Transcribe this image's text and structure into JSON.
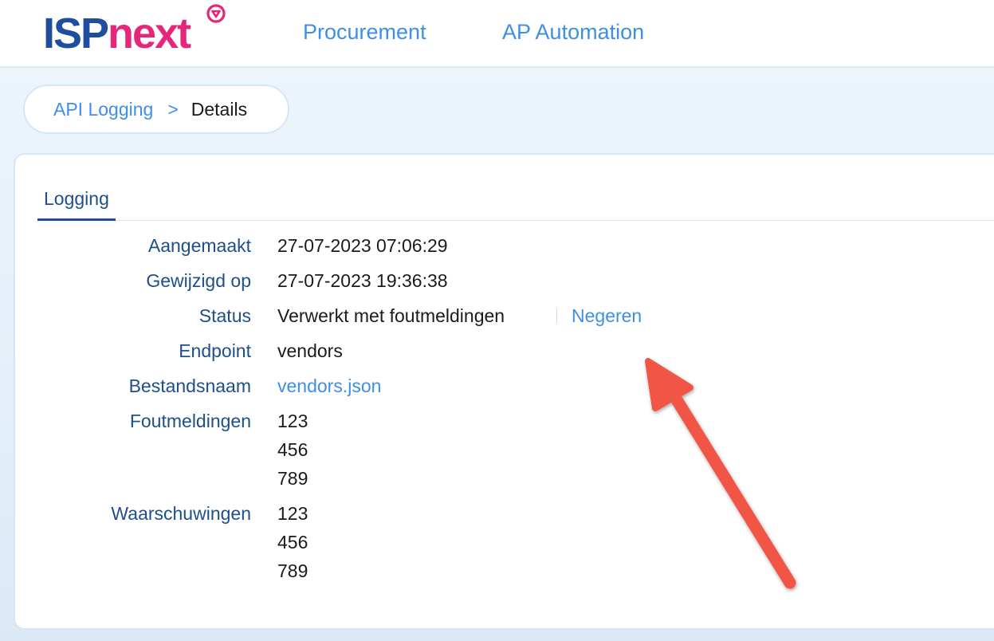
{
  "header": {
    "logo": {
      "part1": "ISP",
      "part2": "next"
    },
    "nav": [
      {
        "label": "Procurement"
      },
      {
        "label": "AP Automation"
      }
    ]
  },
  "breadcrumb": {
    "parent": "API Logging",
    "separator": ">",
    "current": "Details"
  },
  "tabs": [
    {
      "label": "Logging",
      "active": true
    }
  ],
  "details": {
    "created": {
      "label": "Aangemaakt",
      "value": "27-07-2023 07:06:29"
    },
    "modified": {
      "label": "Gewijzigd op",
      "value": "27-07-2023 19:36:38"
    },
    "status": {
      "label": "Status",
      "value": "Verwerkt met foutmeldingen",
      "action": "Negeren"
    },
    "endpoint": {
      "label": "Endpoint",
      "value": "vendors"
    },
    "filename": {
      "label": "Bestandsnaam",
      "value": "vendors.json"
    },
    "errors": {
      "label": "Foutmeldingen",
      "values": [
        "123",
        "456",
        "789"
      ]
    },
    "warnings": {
      "label": "Waarschuwingen",
      "values": [
        "123",
        "456",
        "789"
      ]
    }
  },
  "colors": {
    "brand_blue": "#1f4e9e",
    "brand_pink": "#e5277a",
    "link_blue": "#3e8fe6",
    "label_blue": "#1e4f8a",
    "annotation_arrow": "#f05545"
  },
  "icons": {
    "logo_mark": "triangle-circle-icon",
    "annotation": "arrow-annotation"
  }
}
